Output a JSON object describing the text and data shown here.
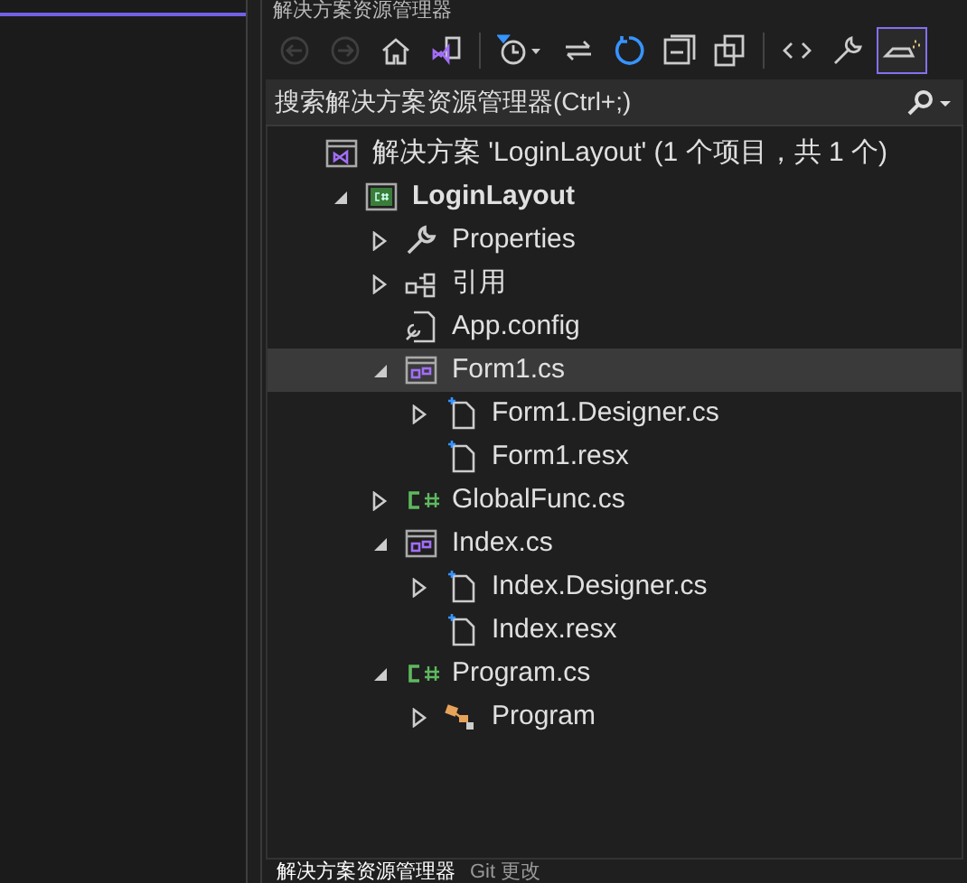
{
  "panel": {
    "title": "解决方案资源管理器"
  },
  "toolbar": [
    {
      "kind": "back",
      "disabled": true,
      "selected": false
    },
    {
      "kind": "forward",
      "disabled": true,
      "selected": false
    },
    {
      "kind": "home",
      "disabled": false,
      "selected": false
    },
    {
      "kind": "switch-views",
      "disabled": false,
      "selected": false
    },
    {
      "kind": "pending-filter",
      "disabled": false,
      "selected": false
    },
    {
      "kind": "sync",
      "disabled": false,
      "selected": false
    },
    {
      "kind": "refresh",
      "disabled": false,
      "selected": false
    },
    {
      "kind": "collapse",
      "disabled": false,
      "selected": false
    },
    {
      "kind": "show-all",
      "disabled": false,
      "selected": false
    },
    {
      "kind": "code",
      "disabled": false,
      "selected": false
    },
    {
      "kind": "properties",
      "disabled": false,
      "selected": false
    },
    {
      "kind": "preview",
      "disabled": false,
      "selected": true
    }
  ],
  "search": {
    "placeholder": "搜索解决方案资源管理器(Ctrl+;)"
  },
  "tree": [
    {
      "label": "解决方案 'LoginLayout' (1 个项目，共 1 个)",
      "kind": "solution",
      "selected": false,
      "children": [
        {
          "label": "LoginLayout",
          "kind": "project",
          "expanded": true,
          "selected": false,
          "children": [
            {
              "label": "Properties",
              "kind": "properties",
              "expanded": false,
              "selected": false
            },
            {
              "label": "引用",
              "kind": "references",
              "expanded": false,
              "selected": false
            },
            {
              "label": "App.config",
              "kind": "config",
              "selected": false
            },
            {
              "label": "Form1.cs",
              "kind": "form",
              "expanded": true,
              "selected": true,
              "children": [
                {
                  "label": "Form1.Designer.cs",
                  "kind": "file",
                  "expanded": false,
                  "selected": false
                },
                {
                  "label": "Form1.resx",
                  "kind": "file",
                  "selected": false
                }
              ]
            },
            {
              "label": "GlobalFunc.cs",
              "kind": "csharp",
              "expanded": false,
              "selected": false
            },
            {
              "label": "Index.cs",
              "kind": "form",
              "expanded": true,
              "selected": false,
              "children": [
                {
                  "label": "Index.Designer.cs",
                  "kind": "file",
                  "expanded": false,
                  "selected": false
                },
                {
                  "label": "Index.resx",
                  "kind": "file",
                  "selected": false
                }
              ]
            },
            {
              "label": "Program.cs",
              "kind": "csharp",
              "expanded": true,
              "selected": false,
              "children": [
                {
                  "label": "Program",
                  "kind": "class",
                  "expanded": false,
                  "selected": false
                }
              ]
            }
          ]
        }
      ]
    }
  ],
  "bottom_tabs": [
    {
      "label": "解决方案资源管理器",
      "selected": true
    },
    {
      "label": "Git 更改",
      "selected": false
    }
  ]
}
